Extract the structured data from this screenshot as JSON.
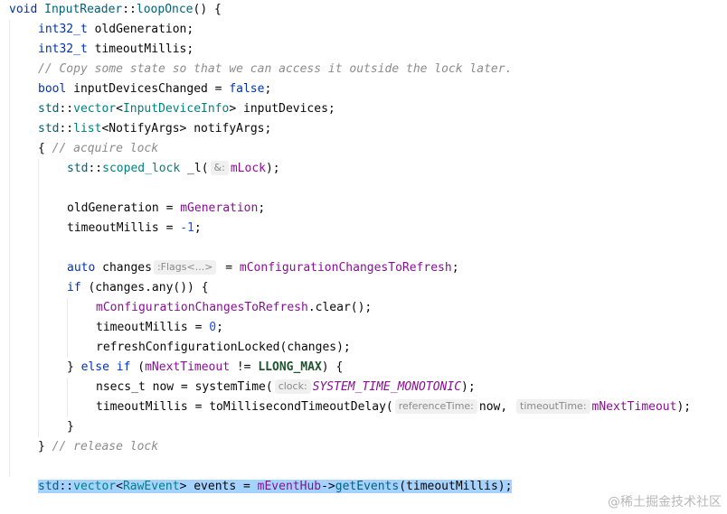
{
  "code": {
    "l1_fn_kw": "void",
    "l1_class": "InputReader",
    "l1_sep": "::",
    "l1_method": "loopOnce",
    "l1_tail": "() {",
    "l2_type": "int32_t",
    "l2_name": " oldGeneration;",
    "l3_type": "int32_t",
    "l3_name": " timeoutMillis;",
    "l4_comment": "// Copy some state so that we can access it outside the lock later.",
    "l5_type": "bool",
    "l5_mid": " inputDevicesChanged = ",
    "l5_val": "false",
    "l5_end": ";",
    "l6_ns": "std",
    "l6_sep": "::",
    "l6_container": "vector",
    "l6_lt": "<",
    "l6_elem": "InputDeviceInfo",
    "l6_tail": "> inputDevices;",
    "l7_ns": "std",
    "l7_sep": "::",
    "l7_container": "list",
    "l7_tail": "<NotifyArgs> notifyArgs;",
    "l8_brace": "{ ",
    "l8_comment": "// acquire lock",
    "l9_ns": "std",
    "l9_sep": "::",
    "l9_type": "scoped_lock",
    "l9_var": " _l(",
    "l9_hint": "&:",
    "l9_arg": "mLock",
    "l9_end": ");",
    "l11_var": "oldGeneration = ",
    "l11_member": "mGeneration",
    "l11_end": ";",
    "l12_var": "timeoutMillis = ",
    "l12_num": "-1",
    "l12_end": ";",
    "l14_kw": "auto",
    "l14_var": " changes",
    "l14_hint": ":Flags<...>",
    "l14_eq": " = ",
    "l14_member": "mConfigurationChangesToRefresh",
    "l14_end": ";",
    "l15_kw": "if",
    "l15_tail": " (changes.any()) {",
    "l16_member": "mConfigurationChangesToRefresh",
    "l16_tail": ".clear();",
    "l17_var": "timeoutMillis = ",
    "l17_num": "0",
    "l17_end": ";",
    "l18_text": "refreshConfigurationLocked(changes);",
    "l19_brace": "} ",
    "l19_else": "else if",
    "l19_open": " (",
    "l19_member": "mNextTimeout",
    "l19_op": " != ",
    "l19_macro": "LLONG_MAX",
    "l19_end": ") {",
    "l20_type": "nsecs_t",
    "l20_mid": " now = systemTime(",
    "l20_hint": "clock:",
    "l20_const": "SYSTEM_TIME_MONOTONIC",
    "l20_end": ");",
    "l21_var": "timeoutMillis = toMillisecondTimeoutDelay(",
    "l21_hint1": "referenceTime:",
    "l21_arg1": "now,",
    "l21_hint2": "timeoutTime:",
    "l21_member": "mNextTimeout",
    "l21_end": ");",
    "l22_brace": "}",
    "l23_brace": "} ",
    "l23_comment": "// release lock",
    "l25_ns": "std",
    "l25_sep": "::",
    "l25_container": "vector",
    "l25_lt": "<",
    "l25_elem": "RawEvent",
    "l25_mid": "> events = ",
    "l25_member": "mEventHub",
    "l25_arrow": "->",
    "l25_call": "getEvents",
    "l25_end": "(timeoutMillis);"
  },
  "watermark": "@稀土掘金技术社区"
}
